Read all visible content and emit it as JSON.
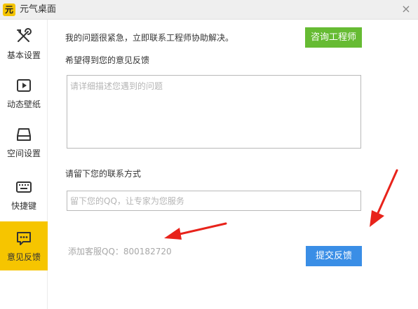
{
  "app": {
    "logo_text": "元",
    "title": "元气桌面",
    "close_glyph": "×"
  },
  "sidebar": {
    "items": [
      {
        "label": "基本设置",
        "icon": "tools-icon",
        "active": false
      },
      {
        "label": "动态壁纸",
        "icon": "play-icon",
        "active": false
      },
      {
        "label": "空间设置",
        "icon": "drive-icon",
        "active": false
      },
      {
        "label": "快捷键",
        "icon": "keyboard-icon",
        "active": false
      },
      {
        "label": "意见反馈",
        "icon": "chat-icon",
        "active": true
      }
    ]
  },
  "main": {
    "urgent_text": "我的问题很紧急，立即联系工程师协助解决。",
    "consult_button": "咨询工程师",
    "feedback_title": "希望得到您的意见反馈",
    "feedback_placeholder": "请详细描述您遇到的问题",
    "feedback_value": "",
    "contact_title": "请留下您的联系方式",
    "contact_placeholder": "留下您的QQ，让专家为您服务",
    "contact_value": "",
    "qq_text": "添加客服QQ：800182720",
    "submit_button": "提交反馈"
  },
  "colors": {
    "accent_yellow": "#f6c500",
    "consult_green": "#66bb33",
    "submit_blue": "#3a8ee6",
    "annotation_red": "#e8231b"
  }
}
